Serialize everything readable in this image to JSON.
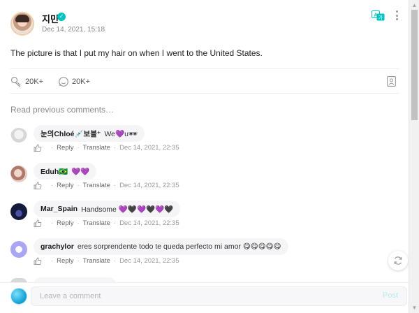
{
  "post": {
    "author": "지민",
    "date": "Dec 14, 2021, 15:18",
    "body": "The picture is that I put my hair on when I went to the United States.",
    "likes": "20K+",
    "comments": "20K+"
  },
  "read_previous": "Read previous comments…",
  "comments": [
    {
      "user": "눈의Chloé💉보블⁺",
      "text": "We💜u🕶",
      "reply": "Reply",
      "translate": "Translate",
      "date": "Dec 14, 2021, 22:35"
    },
    {
      "user": "Eduh🇧🇷",
      "text": "💜💜",
      "reply": "Reply",
      "translate": "Translate",
      "date": "Dec 14, 2021, 22:35"
    },
    {
      "user": "Mar_Spain",
      "text": "Handsome 💜🖤💜🖤💜🖤",
      "reply": "Reply",
      "translate": "Translate",
      "date": "Dec 14, 2021, 22:35"
    },
    {
      "user": "grachylor",
      "text": "eres sorprendente todo te queda perfecto mi amor 😋😋😋😋😋",
      "reply": "Reply",
      "translate": "Translate",
      "date": "Dec 14, 2021, 22:35"
    }
  ],
  "composer": {
    "placeholder": "Leave a comment",
    "post_label": "Post"
  },
  "colors": {
    "accent": "#00c4c4",
    "heart": "#8b5cf6",
    "bubble": "#f5f5f7"
  },
  "icons": [
    "verified-icon",
    "translate-icon",
    "more-icon",
    "like-icon",
    "comment-icon",
    "bookmark-icon",
    "thumb-up-icon",
    "refresh-icon"
  ]
}
